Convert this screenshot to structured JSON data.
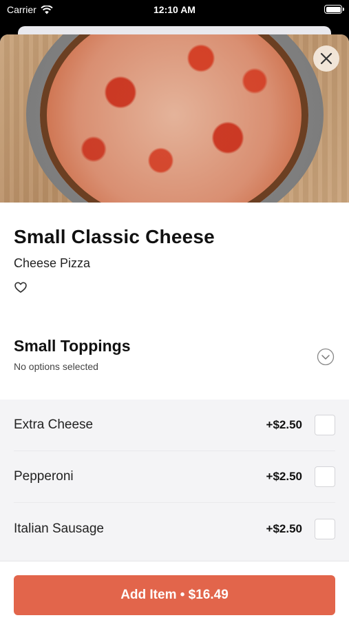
{
  "status_bar": {
    "carrier": "Carrier",
    "time": "12:10 AM"
  },
  "item": {
    "title": "Small Classic Cheese",
    "subtitle": "Cheese Pizza"
  },
  "toppings": {
    "title": "Small Toppings",
    "status": "No options selected",
    "options": [
      {
        "name": "Extra Cheese",
        "price": "+$2.50",
        "checked": false
      },
      {
        "name": "Pepperoni",
        "price": "+$2.50",
        "checked": false
      },
      {
        "name": "Italian Sausage",
        "price": "+$2.50",
        "checked": false
      }
    ]
  },
  "footer": {
    "button_label": "Add Item • $16.49"
  },
  "icons": {
    "close": "close-icon",
    "favorite": "heart-icon",
    "expand": "chevron-down-icon"
  },
  "colors": {
    "accent": "#e2654b"
  }
}
